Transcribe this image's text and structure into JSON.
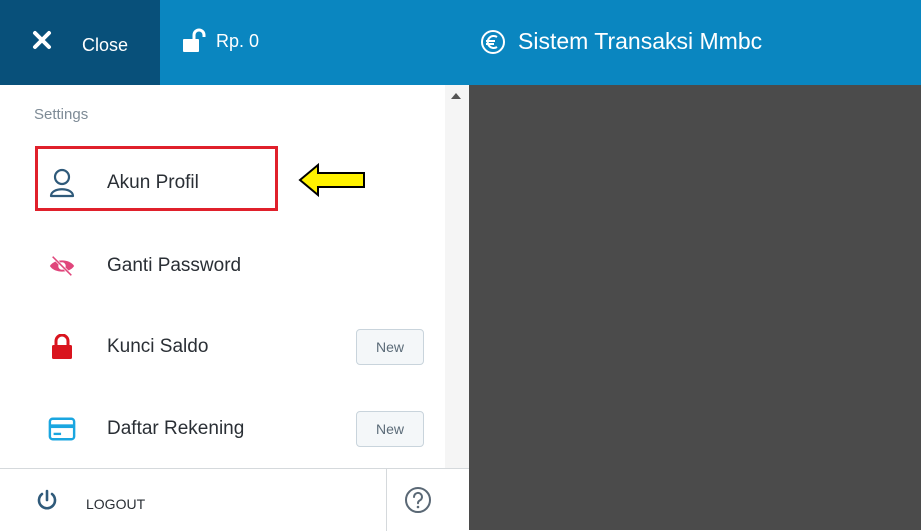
{
  "topbar": {
    "close_label": "Close",
    "balance_label": "Rp. 0",
    "app_title": "Sistem Transaksi Mmbc"
  },
  "sidebar": {
    "section_label": "Settings",
    "items": [
      {
        "label": "Akun Profil",
        "icon": "user-icon"
      },
      {
        "label": "Ganti Password",
        "icon": "eye-slash-icon"
      },
      {
        "label": "Kunci Saldo",
        "icon": "lock-icon",
        "badge": "New"
      },
      {
        "label": "Daftar Rekening",
        "icon": "credit-card-icon",
        "badge": "New"
      }
    ],
    "footer": {
      "logout_label": "LOGOUT"
    }
  },
  "colors": {
    "topbar": "#0a86c0",
    "close_button": "#08507a",
    "highlight_border": "#e0202b",
    "arrow_fill": "#fff200",
    "content_bg": "#4b4b4b"
  }
}
